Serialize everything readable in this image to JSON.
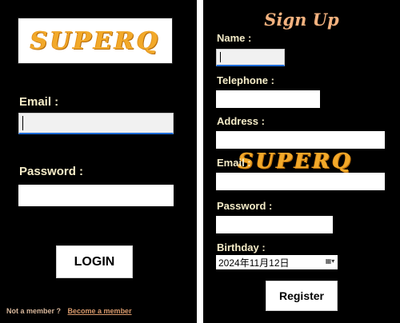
{
  "login": {
    "logo_text": "SUPERQ",
    "email_label": "Email :",
    "email_value": "",
    "password_label": "Password :",
    "password_value": "",
    "login_button": "LOGIN",
    "footer_question": "Not a member ?",
    "footer_link": "Become a member"
  },
  "signup": {
    "title": "Sign Up",
    "name_label": "Name :",
    "telephone_label": "Telephone :",
    "address_label": "Address :",
    "email_label": "Email :",
    "password_label": "Password :",
    "birthday_label": "Birthday :",
    "birthday_value": "2024年11月12日",
    "calendar_icon": "calendar-icon",
    "register_button": "Register",
    "watermark_logo_text": "SUPERQ"
  },
  "colors": {
    "background": "#000000",
    "label": "#f5ecc8",
    "title": "#f3b27f",
    "logo": "#f2a92a",
    "focus_underline": "#1e6bd6"
  }
}
